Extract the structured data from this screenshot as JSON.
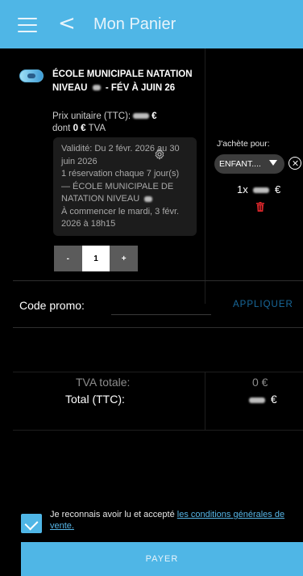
{
  "appbar": {
    "menu_icon": "hamburger-menu-icon",
    "back_icon": "chevron-left-icon",
    "back_glyph": "<",
    "title": "Mon Panier",
    "color": "#4fb6e6"
  },
  "cart": {
    "item": {
      "thumbnail_icon": "swimmer-thumbnail-icon",
      "name": "ÉCOLE MUNICIPALE NATATION NIVEAU",
      "name_suffix": "- FÉV À JUIN 26",
      "unit_price_label": "Prix unitaire (TTC):",
      "unit_price_currency": "€",
      "tax_prefix": "dont",
      "tax_value": "0 €",
      "tax_suffix": "TVA",
      "details": "Validité: Du 2 févr. 2026 au 30 juin 2026\n1 réservation chaque 7 jour(s) — ÉCOLE MUNICIPALE DE NATATION NIVEAU",
      "details_start": "À commencer le mardi, 3 févr. 2026 à 18h15",
      "gear_icon": "gear-icon",
      "stepper": {
        "minus": "-",
        "quantity": "1",
        "plus": "+"
      }
    },
    "buyer": {
      "label": "J'achète pour:",
      "selected": "ENFANT....",
      "clear_icon": "close-circle-icon"
    },
    "line_total": {
      "quantity": "1x",
      "currency": "€"
    },
    "delete_icon": "trash-icon"
  },
  "promo": {
    "label": "Code promo:",
    "placeholder": "",
    "apply_label": "APPLIQUER"
  },
  "totals": {
    "tva_label": "TVA totale:",
    "tva_value": "0 €",
    "total_label": "Total (TTC):",
    "total_currency": "€"
  },
  "terms": {
    "text": "Je reconnais avoir lu et accepté",
    "link_part1": "les conditions",
    "link_part2": "générales de vente.",
    "checked": true
  },
  "pay_button": {
    "label": "PAYER"
  }
}
